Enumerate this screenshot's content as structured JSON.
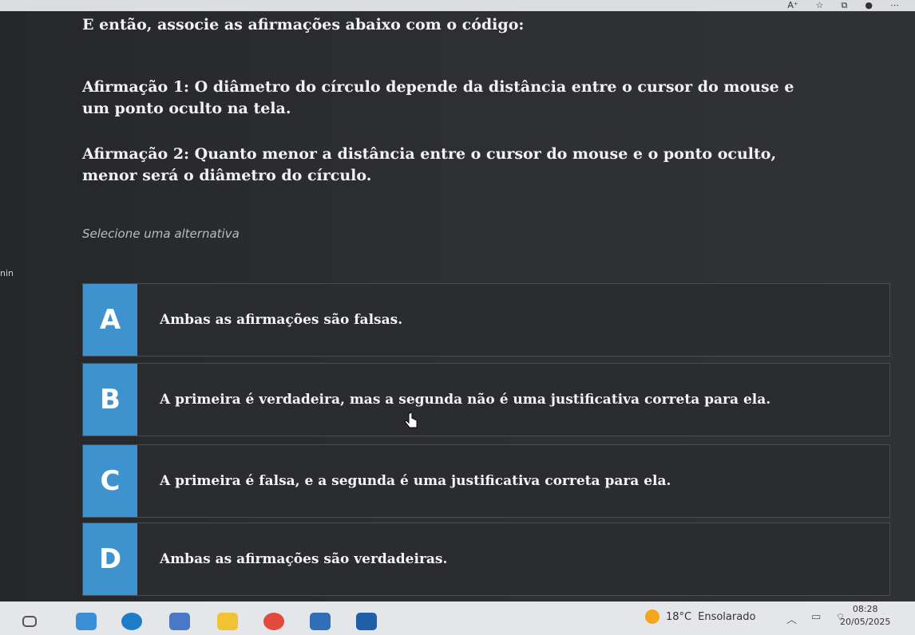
{
  "question": {
    "intro": "E então, associe as afirmações abaixo com o código:",
    "statement1": "Afirmação 1: O diâmetro do círculo depende da distância entre o cursor do mouse e um ponto oculto na tela.",
    "statement2": "Afirmação 2: Quanto menor a distância entre o cursor do mouse e o ponto oculto, menor será o diâmetro do círculo.",
    "prompt": "Selecione uma alternativa",
    "edge_text": "nin"
  },
  "options": [
    {
      "letter": "A",
      "text": "Ambas as afirmações são falsas."
    },
    {
      "letter": "B",
      "text": "A primeira é verdadeira, mas a segunda não é uma justificativa correta para ela."
    },
    {
      "letter": "C",
      "text": "A primeira é falsa, e a segunda é uma justificativa correta para ela."
    },
    {
      "letter": "D",
      "text": "Ambas as afirmações são verdadeiras."
    }
  ],
  "taskbar": {
    "temperature": "18°C",
    "weather": "Ensolarado",
    "time": "08:28",
    "date": "20/05/2025"
  },
  "colors": {
    "letter_badge": "#3e93cf",
    "background": "#2b2d31"
  },
  "icons": [
    "read-aloud-icon",
    "favorite-star-icon",
    "collections-icon",
    "profile-avatar-icon",
    "more-icon"
  ]
}
